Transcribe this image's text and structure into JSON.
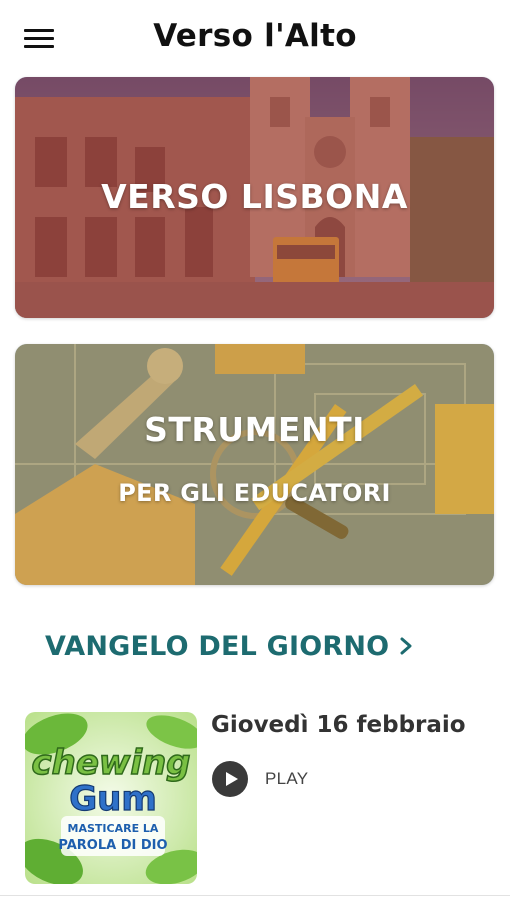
{
  "header": {
    "title": "Verso l'Alto",
    "menu_icon": "hamburger-menu-icon"
  },
  "cards": [
    {
      "id": "lisbona",
      "title": "VERSO LISBONA",
      "overlay_color": "#b04a4a"
    },
    {
      "id": "strumenti",
      "title": "STRUMENTI",
      "subtitle": "PER GLI EDUCATORI",
      "overlay_color": "#c9a24a"
    }
  ],
  "gospel": {
    "section_title": "VANGELO DEL GIORNO",
    "section_color": "#1d6b70",
    "chevron_icon": "chevron-right-icon",
    "item": {
      "date": "Giovedì 16 febbraio",
      "play_label": "PLAY",
      "play_icon": "play-circle-icon",
      "thumbnail": {
        "line1": "chewing",
        "line2": "Gum",
        "line3": "MASTICARE LA",
        "line4": "PAROLA DI DIO"
      }
    }
  }
}
